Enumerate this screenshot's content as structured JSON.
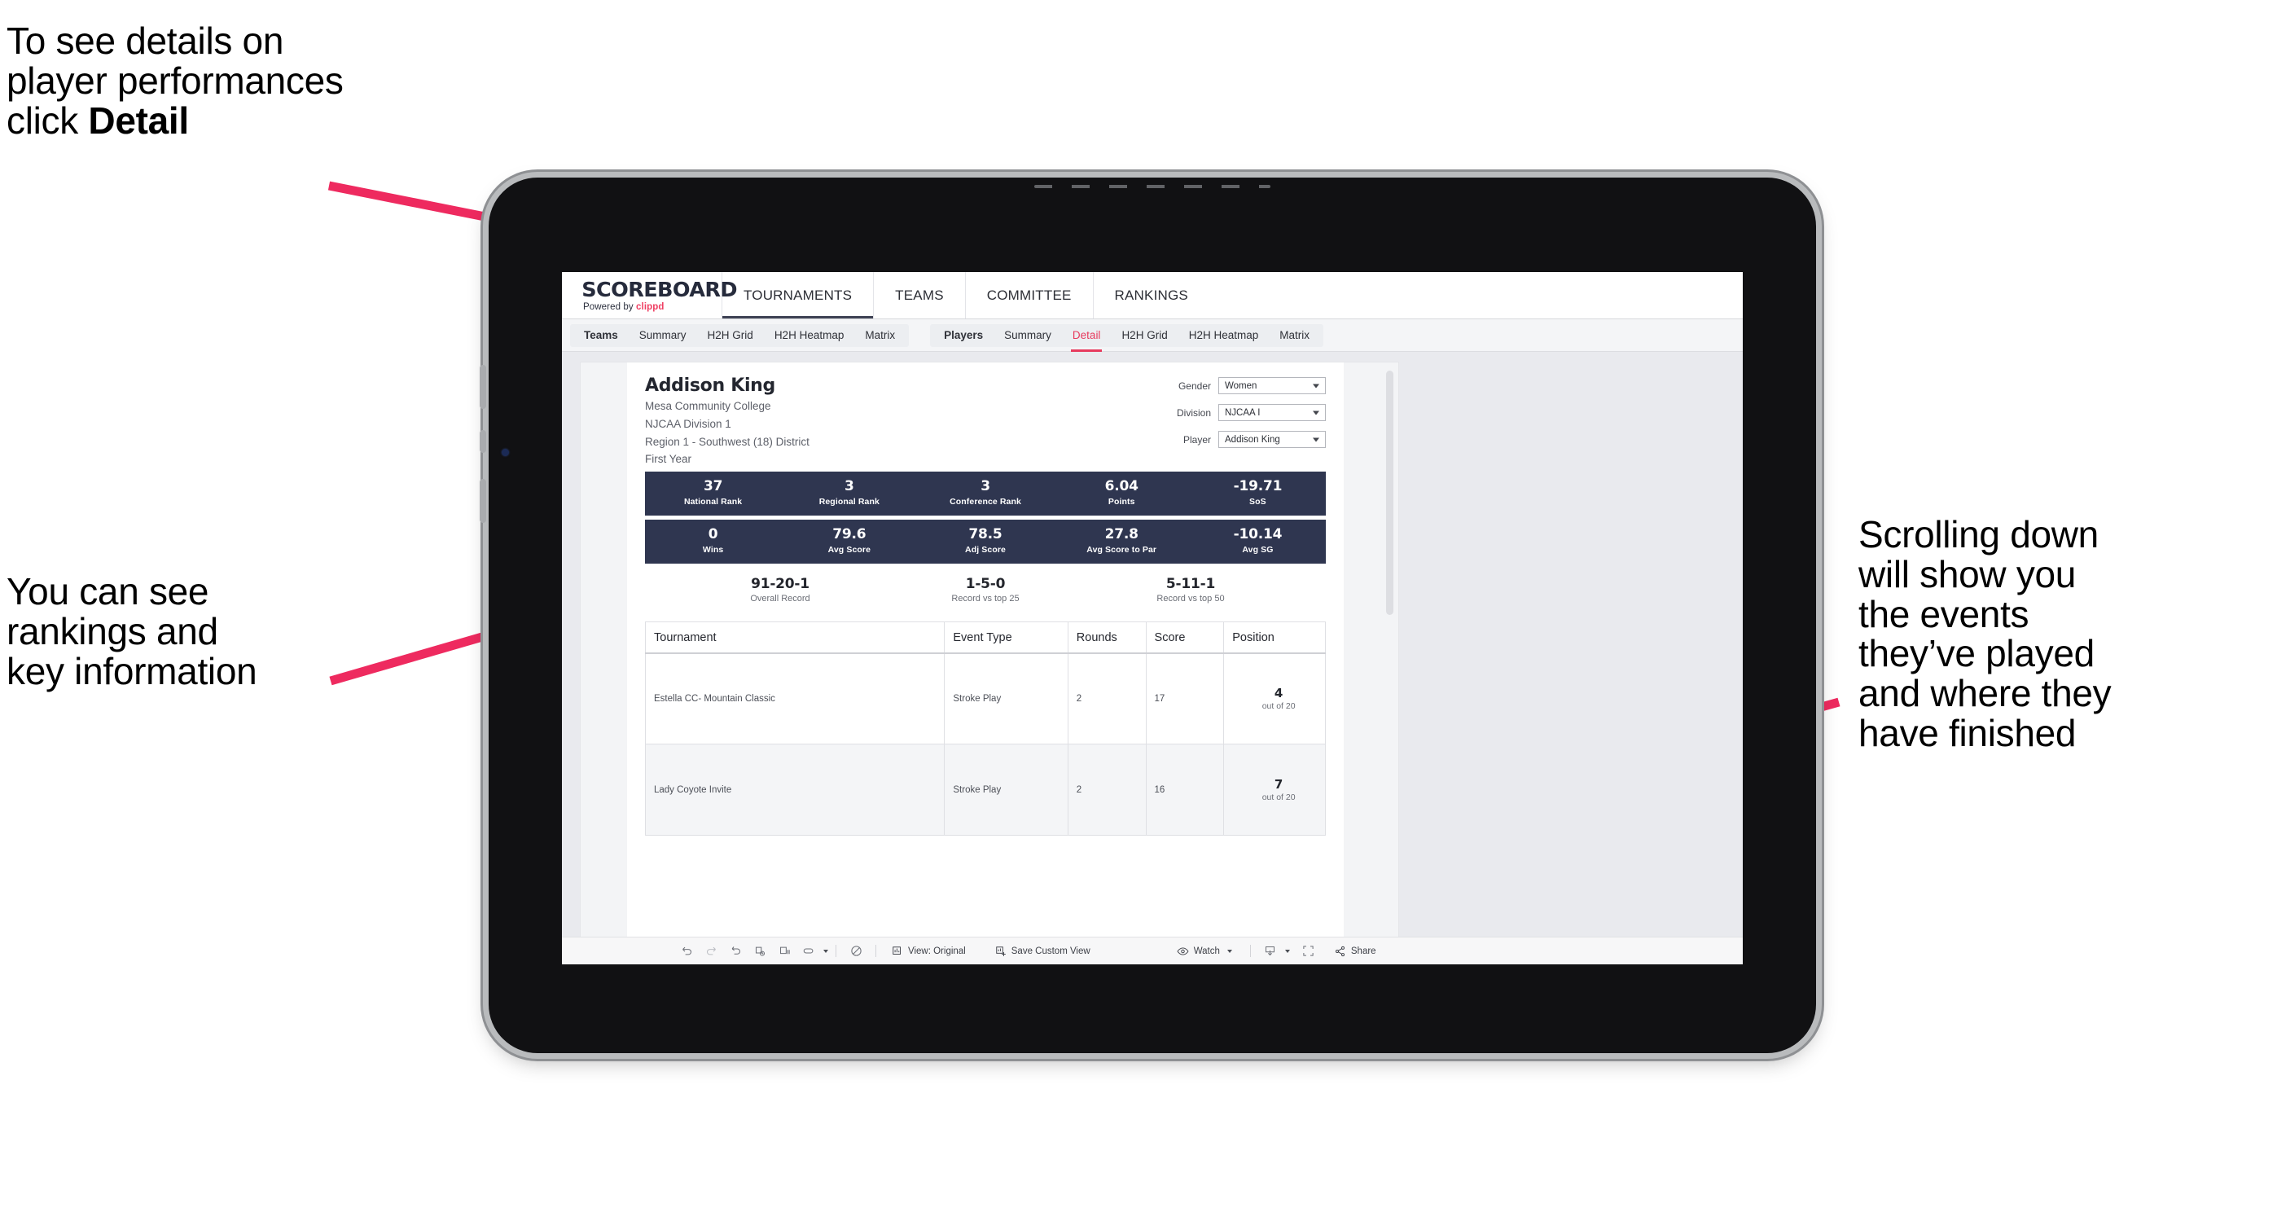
{
  "annotations": {
    "top_left": "To see details on\nplayer performances\nclick ",
    "top_left_bold": "Detail",
    "mid_left": "You can see\nrankings and\nkey information",
    "right": "Scrolling down\nwill show you\nthe events\nthey’ve played\nand where they\nhave finished"
  },
  "brand": {
    "title": "SCOREBOARD",
    "powered_prefix": "Powered by ",
    "powered_brand": "clippd"
  },
  "topnav": [
    {
      "label": "TOURNAMENTS"
    },
    {
      "label": "TEAMS"
    },
    {
      "label": "COMMITTEE"
    },
    {
      "label": "RANKINGS"
    }
  ],
  "subnav": {
    "teams_group": [
      {
        "label": "Teams",
        "head": true
      },
      {
        "label": "Summary"
      },
      {
        "label": "H2H Grid"
      },
      {
        "label": "H2H Heatmap"
      },
      {
        "label": "Matrix"
      }
    ],
    "players_group": [
      {
        "label": "Players",
        "head": true
      },
      {
        "label": "Summary"
      },
      {
        "label": "Detail",
        "active": true
      },
      {
        "label": "H2H Grid"
      },
      {
        "label": "H2H Heatmap"
      },
      {
        "label": "Matrix"
      }
    ]
  },
  "player": {
    "name": "Addison King",
    "school": "Mesa Community College",
    "division": "NJCAA Division 1",
    "region": "Region 1 - Southwest (18) District",
    "year": "First Year"
  },
  "filters": [
    {
      "label": "Gender",
      "value": "Women"
    },
    {
      "label": "Division",
      "value": "NJCAA I"
    },
    {
      "label": "Player",
      "value": "Addison King"
    }
  ],
  "stats_row1": [
    {
      "value": "37",
      "label": "National Rank"
    },
    {
      "value": "3",
      "label": "Regional Rank"
    },
    {
      "value": "3",
      "label": "Conference Rank"
    },
    {
      "value": "6.04",
      "label": "Points"
    },
    {
      "value": "-19.71",
      "label": "SoS"
    }
  ],
  "stats_row2": [
    {
      "value": "0",
      "label": "Wins"
    },
    {
      "value": "79.6",
      "label": "Avg Score"
    },
    {
      "value": "78.5",
      "label": "Adj Score"
    },
    {
      "value": "27.8",
      "label": "Avg Score to Par"
    },
    {
      "value": "-10.14",
      "label": "Avg SG"
    }
  ],
  "records": [
    {
      "value": "91-20-1",
      "label": "Overall Record"
    },
    {
      "value": "1-5-0",
      "label": "Record vs top 25"
    },
    {
      "value": "5-11-1",
      "label": "Record vs top 50"
    }
  ],
  "events_table": {
    "columns": [
      "Tournament",
      "Event Type",
      "Rounds",
      "Score",
      "Position"
    ],
    "rows": [
      {
        "tournament": "Estella CC- Mountain Classic",
        "event_type": "Stroke Play",
        "rounds": "2",
        "score": "17",
        "position": "4",
        "position_of": "out of 20"
      },
      {
        "tournament": "Lady Coyote Invite",
        "event_type": "Stroke Play",
        "rounds": "2",
        "score": "16",
        "position": "7",
        "position_of": "out of 20"
      }
    ]
  },
  "toolbar": {
    "view_label": "View: Original",
    "save_label": "Save Custom View",
    "watch_label": "Watch",
    "share_label": "Share"
  },
  "colors": {
    "accent_pink": "#e73b5e",
    "stat_bar": "#2f3650",
    "arrow": "#ee2a5f"
  }
}
